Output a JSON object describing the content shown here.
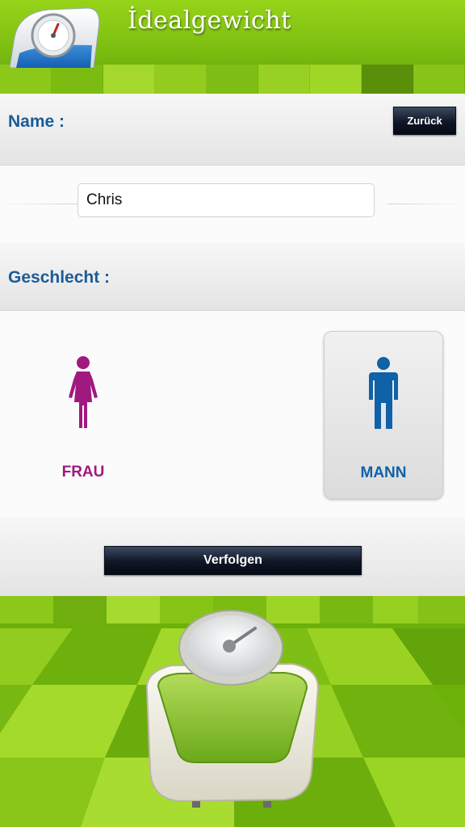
{
  "header": {
    "title": "İdealgewicht"
  },
  "name_section": {
    "label": "Name :",
    "back_button": "Zurück"
  },
  "name_input": {
    "value": "Chris"
  },
  "gender_section": {
    "label": "Geschlecht :"
  },
  "gender_options": [
    {
      "label": "FRAU",
      "color": "#a0197f",
      "selected": false
    },
    {
      "label": "MANN",
      "color": "#0f61a8",
      "selected": true
    }
  ],
  "actions": {
    "continue_button": "Verfolgen"
  },
  "colors": {
    "accent_green": "#7bbd10",
    "label_blue": "#1c5c97"
  }
}
